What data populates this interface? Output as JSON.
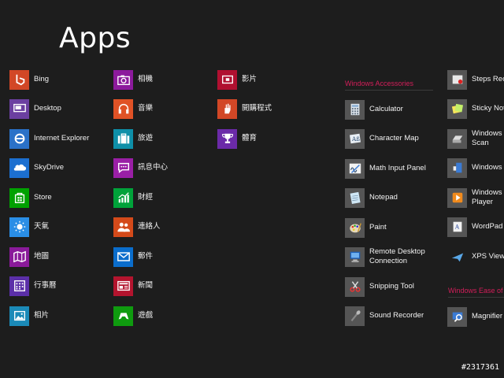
{
  "page": {
    "title": "Apps"
  },
  "groups": {
    "col1": [
      {
        "label": "Bing",
        "icon": "bing-icon",
        "color": "#d24726"
      },
      {
        "label": "Desktop",
        "icon": "desktop-icon",
        "color": "#6b3fa0"
      },
      {
        "label": "Internet Explorer",
        "icon": "internet-explorer-icon",
        "color": "#2a71c8"
      },
      {
        "label": "SkyDrive",
        "icon": "cloud-icon",
        "color": "#1c6fd0"
      },
      {
        "label": "Store",
        "icon": "store-icon",
        "color": "#00a100"
      },
      {
        "label": "天氣",
        "icon": "sun-icon",
        "color": "#2a8ee6"
      },
      {
        "label": "地圖",
        "icon": "map-icon",
        "color": "#8a1a9a"
      },
      {
        "label": "行事曆",
        "icon": "calendar-icon",
        "color": "#5b2fa8"
      },
      {
        "label": "相片",
        "icon": "photo-icon",
        "color": "#1b8ab8"
      }
    ],
    "col2": [
      {
        "label": "相機",
        "icon": "camera-icon",
        "color": "#8c1a9c"
      },
      {
        "label": "音樂",
        "icon": "headphones-icon",
        "color": "#e05226"
      },
      {
        "label": "旅遊",
        "icon": "suitcase-icon",
        "color": "#0e8fa8"
      },
      {
        "label": "訊息中心",
        "icon": "message-icon",
        "color": "#9a1fa6"
      },
      {
        "label": "財經",
        "icon": "chart-icon",
        "color": "#00a23a"
      },
      {
        "label": "連絡人",
        "icon": "people-icon",
        "color": "#d44a1a"
      },
      {
        "label": "郵件",
        "icon": "mail-icon",
        "color": "#0a6dcc"
      },
      {
        "label": "新聞",
        "icon": "news-icon",
        "color": "#b3142e"
      },
      {
        "label": "遊戲",
        "icon": "game-controller-icon",
        "color": "#0f9b0f"
      }
    ],
    "col3": [
      {
        "label": "影片",
        "icon": "video-icon",
        "color": "#b01030"
      },
      {
        "label": "開購程式",
        "icon": "hand-icon",
        "color": "#d24726"
      },
      {
        "label": "體育",
        "icon": "trophy-icon",
        "color": "#6b2aa8"
      }
    ],
    "accessories": {
      "heading": "Windows Accessories",
      "items": [
        {
          "label": "Calculator",
          "icon": "calculator-icon"
        },
        {
          "label": "Character Map",
          "icon": "character-map-icon"
        },
        {
          "label": "Math Input Panel",
          "icon": "math-input-icon"
        },
        {
          "label": "Notepad",
          "icon": "notepad-icon"
        },
        {
          "label": "Paint",
          "icon": "paint-icon"
        },
        {
          "label": "Remote Desktop Connection",
          "icon": "remote-desktop-icon"
        },
        {
          "label": "Snipping Tool",
          "icon": "scissors-icon"
        },
        {
          "label": "Sound Recorder",
          "icon": "microphone-icon"
        }
      ]
    },
    "col5": [
      {
        "label": "Steps Reco",
        "icon": "steps-recorder-icon"
      },
      {
        "label": "Sticky Not",
        "icon": "sticky-notes-icon"
      },
      {
        "label": "Windows Scan",
        "icon": "scanner-icon"
      },
      {
        "label": "Windows",
        "icon": "windows-journal-icon"
      },
      {
        "label": "Windows Player",
        "icon": "media-player-icon"
      },
      {
        "label": "WordPad",
        "icon": "wordpad-icon"
      },
      {
        "label": "XPS View",
        "icon": "xps-viewer-icon"
      }
    ],
    "ease": {
      "heading": "Windows Ease of",
      "items": [
        {
          "label": "Magnifier",
          "icon": "magnifier-icon"
        }
      ]
    }
  },
  "watermark": "#2317361"
}
